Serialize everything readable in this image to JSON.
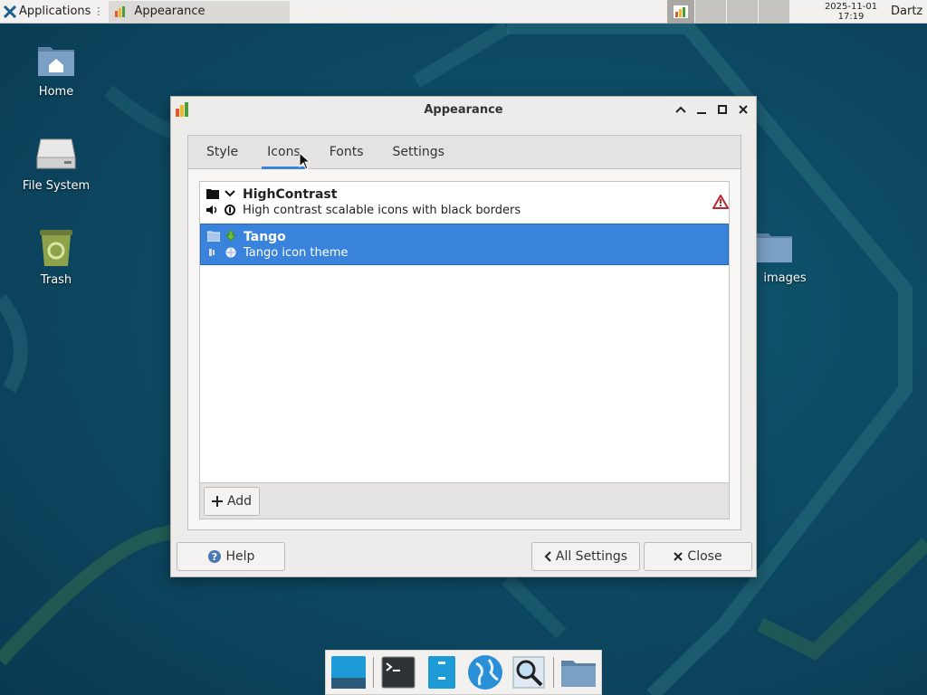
{
  "top_panel": {
    "applications_label": "Applications",
    "task_title": "Appearance",
    "clock_date": "2025-11-01",
    "clock_time": "17:19",
    "user_name": "Dartz"
  },
  "desktop": {
    "icons": [
      {
        "label": "Home",
        "icon": "home-folder-icon"
      },
      {
        "label": "File System",
        "icon": "drive-icon"
      },
      {
        "label": "Trash",
        "icon": "trash-icon"
      },
      {
        "label": "images",
        "icon": "folder-icon"
      }
    ]
  },
  "window": {
    "title": "Appearance",
    "tabs": [
      {
        "label": "Style"
      },
      {
        "label": "Icons",
        "active": true
      },
      {
        "label": "Fonts"
      },
      {
        "label": "Settings"
      }
    ],
    "themes": [
      {
        "name": "HighContrast",
        "description": "High contrast scalable icons with black borders",
        "warning": true,
        "selected": false
      },
      {
        "name": "Tango",
        "description": "Tango icon theme",
        "warning": false,
        "selected": true
      }
    ],
    "add_label": "Add",
    "help_label": "Help",
    "all_settings_label": "All Settings",
    "close_label": "Close"
  },
  "dock": {
    "items": [
      "desktop-icon",
      "terminal-icon",
      "file-manager-icon",
      "web-browser-icon",
      "search-icon",
      "folder-icon"
    ]
  },
  "colors": {
    "accent": "#3a83dd",
    "desktop": "#0d4a64",
    "panel": "#f2f1f0"
  }
}
